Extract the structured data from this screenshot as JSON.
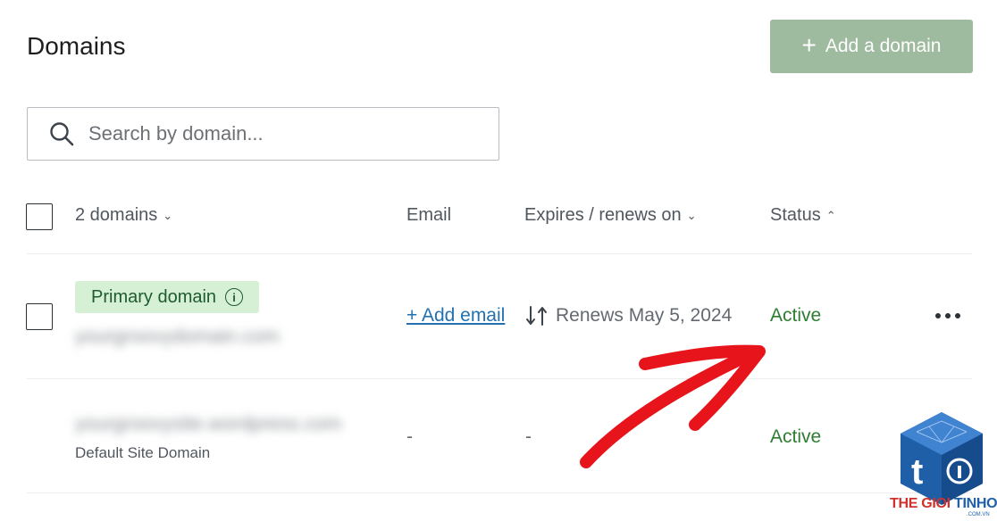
{
  "header": {
    "title": "Domains",
    "add_button_label": "Add a domain",
    "add_button_color": "#9fbb9f"
  },
  "search": {
    "placeholder": "Search by domain..."
  },
  "table": {
    "headers": {
      "domains": "2 domains",
      "email": "Email",
      "expires": "Expires / renews on",
      "status": "Status"
    },
    "rows": [
      {
        "badge": "Primary domain",
        "domain": "yourgroovydomain.com",
        "email_action": "+ Add email",
        "renews": "Renews May 5, 2024",
        "status": "Active"
      },
      {
        "domain": "yourgroovysite.wordpress.com",
        "sublabel": "Default Site Domain",
        "email": "-",
        "expires": "-",
        "status": "Active"
      }
    ],
    "status_color": "#2e7d32",
    "link_color": "#2271b1"
  },
  "watermark": {
    "brand_part1": "THE GIOI",
    "brand_part2": "TINHOC",
    "domain_suffix": ".COM.VN"
  }
}
